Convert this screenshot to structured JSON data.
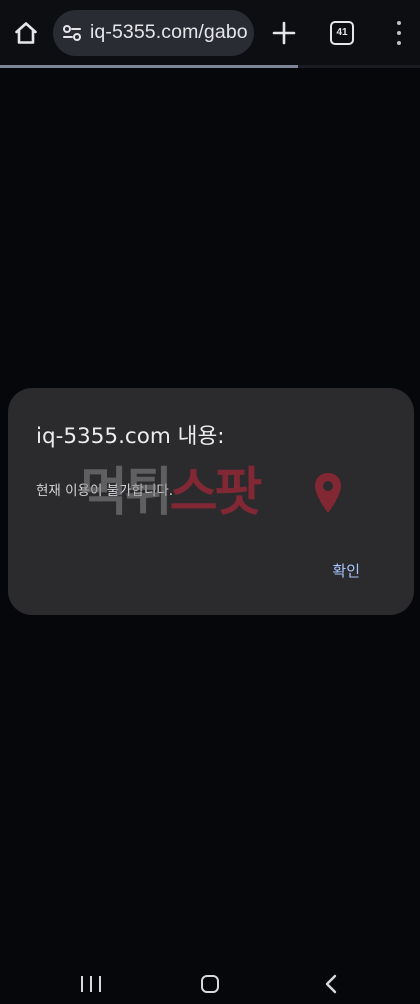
{
  "browser": {
    "url": "iq-5355.com/gabo",
    "tab_count": "41",
    "load_progress": 0.71
  },
  "dialog": {
    "title": "iq-5355.com 내용:",
    "message": "현재 이용이 불가합니다.",
    "ok_label": "확인"
  },
  "watermark": {
    "text_a": "먹튀",
    "text_b": "스팟"
  },
  "colors": {
    "background": "#06070b",
    "dialog_bg": "#2b2b2e",
    "ok_button": "#a9c3ff",
    "watermark_red": "#c9253a"
  },
  "icons": {
    "home": "home-icon",
    "site_settings": "site-settings-icon",
    "new_tab": "plus-icon",
    "tabs": "tab-switcher-icon",
    "menu": "more-vert-icon",
    "nav_recents": "recents-icon",
    "nav_home": "nav-home-icon",
    "nav_back": "back-chevron-icon"
  }
}
